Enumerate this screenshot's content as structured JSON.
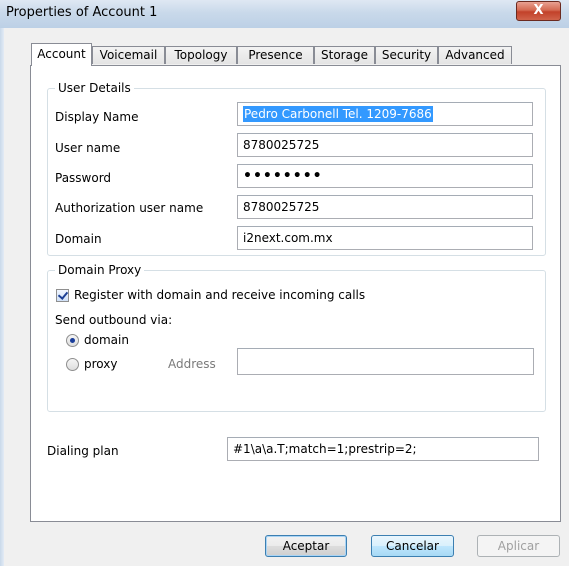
{
  "window": {
    "title": "Properties of Account 1",
    "close_glyph": "X"
  },
  "tabs": [
    {
      "label": "Account",
      "active": true
    },
    {
      "label": "Voicemail",
      "active": false
    },
    {
      "label": "Topology",
      "active": false
    },
    {
      "label": "Presence",
      "active": false
    },
    {
      "label": "Storage",
      "active": false
    },
    {
      "label": "Security",
      "active": false
    },
    {
      "label": "Advanced",
      "active": false
    }
  ],
  "user_details": {
    "legend": "User Details",
    "display_name": {
      "label": "Display Name",
      "value": "Pedro Carbonell  Tel. 1209-7686"
    },
    "user_name": {
      "label": "User name",
      "value": "8780025725"
    },
    "password": {
      "label": "Password",
      "value": "••••••••"
    },
    "auth_user_name": {
      "label": "Authorization user name",
      "value": "8780025725"
    },
    "domain": {
      "label": "Domain",
      "value": "i2next.com.mx"
    }
  },
  "domain_proxy": {
    "legend": "Domain Proxy",
    "register_label": "Register with domain and receive incoming calls",
    "register_checked": true,
    "send_outbound_label": "Send outbound via:",
    "options": [
      {
        "label": "domain",
        "selected": true
      },
      {
        "label": "proxy",
        "selected": false
      }
    ],
    "address_label": "Address",
    "address_value": ""
  },
  "dialing_plan": {
    "label": "Dialing plan",
    "value": "#1\\a\\a.T;match=1;prestrip=2;"
  },
  "buttons": {
    "accept": "Aceptar",
    "cancel": "Cancelar",
    "apply": "Aplicar"
  }
}
